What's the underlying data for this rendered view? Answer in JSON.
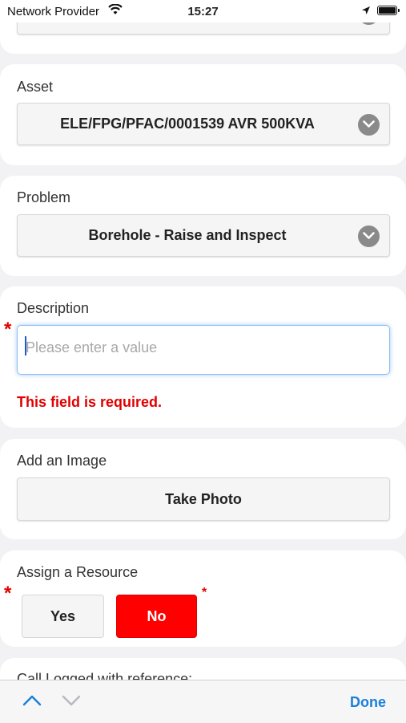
{
  "status_bar": {
    "carrier": "Network Provider",
    "time": "15:27"
  },
  "asset": {
    "label": "Asset",
    "value": "ELE/FPG/PFAC/0001539 AVR 500KVA"
  },
  "problem": {
    "label": "Problem",
    "value": "Borehole - Raise and Inspect"
  },
  "description": {
    "label": "Description",
    "placeholder": "Please enter a value",
    "required_mark": "*",
    "error": "This field is required."
  },
  "image": {
    "label": "Add an Image",
    "button": "Take Photo"
  },
  "resource": {
    "label": "Assign a Resource",
    "required_mark": "*",
    "yes": "Yes",
    "no": "No",
    "selected": "No"
  },
  "call_logged": {
    "label": "Call Logged with reference:"
  },
  "toolbar": {
    "done": "Done"
  },
  "colors": {
    "error": "#e00000",
    "selected_button": "#ff0000",
    "accent": "#1a7fd8"
  }
}
